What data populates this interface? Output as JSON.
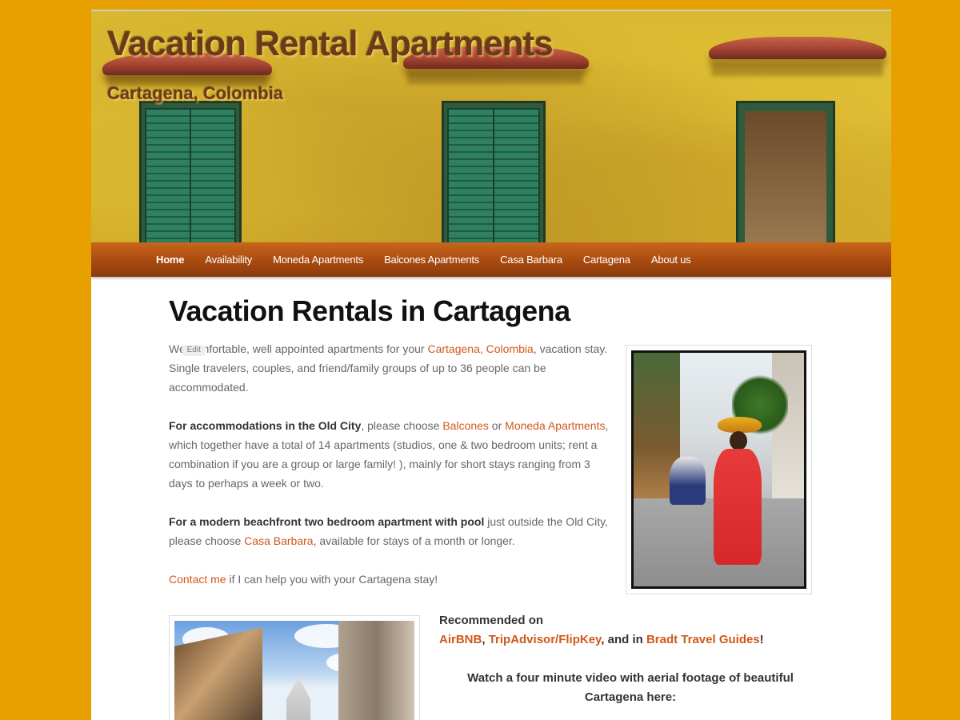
{
  "header": {
    "site_title": "Vacation Rental Apartments",
    "site_subtitle": "Cartagena, Colombia"
  },
  "nav": {
    "items": [
      {
        "label": "Home",
        "active": true
      },
      {
        "label": "Availability"
      },
      {
        "label": "Moneda Apartments"
      },
      {
        "label": "Balcones Apartments"
      },
      {
        "label": "Casa Barbara"
      },
      {
        "label": "Cartagena"
      },
      {
        "label": "About us"
      }
    ]
  },
  "entry": {
    "title": "Vacation Rentals in Cartagena",
    "edit_label": "Edit",
    "p1": {
      "before": "We ",
      "after_edit": "comfortable, well appointed apartments for your ",
      "link1": "Cartagena",
      "sep": ", ",
      "link2": "Colombia",
      "after": ", vacation stay. Single travelers, couples, and friend/family groups of up to 36 people can be accommodated."
    },
    "p2": {
      "bold": "For accommodations in the Old City",
      "t1": ", please choose ",
      "link1": "Balcones",
      "t2": " or ",
      "link2": "Moneda Apartments",
      "t3": ", which together have a  total of 14 apartments (studios, one & two bedroom units; rent a combination if you are a group or large family! ), mainly for short stays ranging from 3 days to perhaps a week or two."
    },
    "p3": {
      "bold": "For a modern beachfront two bedroom apartment with pool",
      "t1": " just outside the Old City, please choose ",
      "link1": "Casa Barbara",
      "t2": ", available for stays of a month or longer."
    },
    "p4": {
      "link1": "Contact me",
      "t1": " if I can help you with your Cartagena stay!"
    }
  },
  "recommended": {
    "heading": "Recommended on",
    "link1": "AirBNB",
    "sep1": ", ",
    "link2": "TripAdvisor/FlipKey",
    "sep2": ", and in ",
    "link3": "Bradt Travel Guides",
    "end": "!"
  },
  "video_note": "Watch a four minute video with aerial footage of beautiful Cartagena here:"
}
